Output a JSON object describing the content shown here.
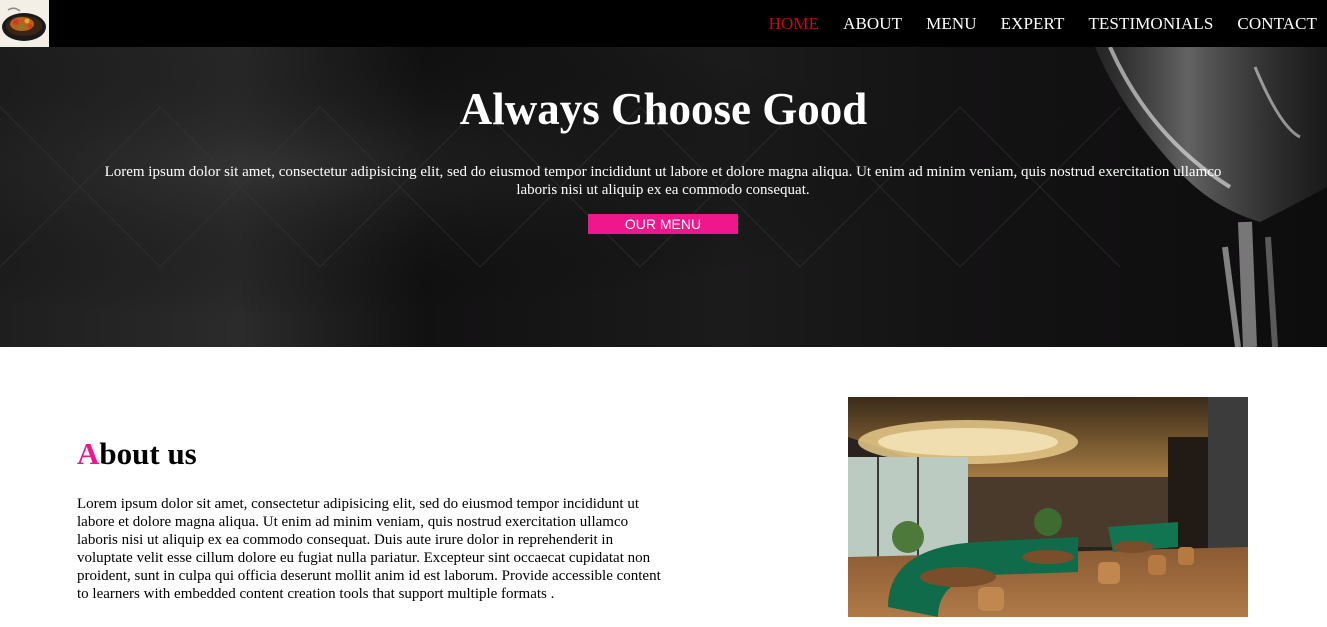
{
  "nav": {
    "logo_icon": "plated-dish-logo-icon",
    "links": [
      {
        "label": "HOME",
        "active": true
      },
      {
        "label": "ABOUT",
        "active": false
      },
      {
        "label": "MENU",
        "active": false
      },
      {
        "label": "EXPERT",
        "active": false
      },
      {
        "label": "TESTIMONIALS",
        "active": false
      },
      {
        "label": "CONTACT",
        "active": false
      }
    ]
  },
  "hero": {
    "title": "Always Choose Good",
    "text": "Lorem ipsum dolor sit amet, consectetur adipisicing elit, sed do eiusmod tempor incididunt ut labore et dolore magna aliqua. Ut enim ad minim veniam, quis nostrud exercitation ullamco laboris nisi ut aliquip ex ea commodo consequat.",
    "button_label": "OUR MENU",
    "background_icon": "wine-glass-image"
  },
  "about": {
    "title_first_letter": "A",
    "title_rest": "bout us",
    "text": "Lorem ipsum dolor sit amet, consectetur adipisicing elit, sed do eiusmod tempor incididunt ut labore et dolore magna aliqua. Ut enim ad minim veniam, quis nostrud exercitation ullamco laboris nisi ut aliquip ex ea commodo consequat. Duis aute irure dolor in reprehenderit in voluptate velit esse cillum dolore eu fugiat nulla pariatur. Excepteur sint occaecat cupidatat non proident, sunt in culpa qui officia deserunt mollit anim id est laborum. Provide accessible content to learners with embedded content creation tools that support multiple formats .",
    "image_icon": "restaurant-interior-image"
  },
  "colors": {
    "accent": "#f0168c",
    "nav_active": "#c40d0d",
    "nav_bg": "#000000"
  }
}
